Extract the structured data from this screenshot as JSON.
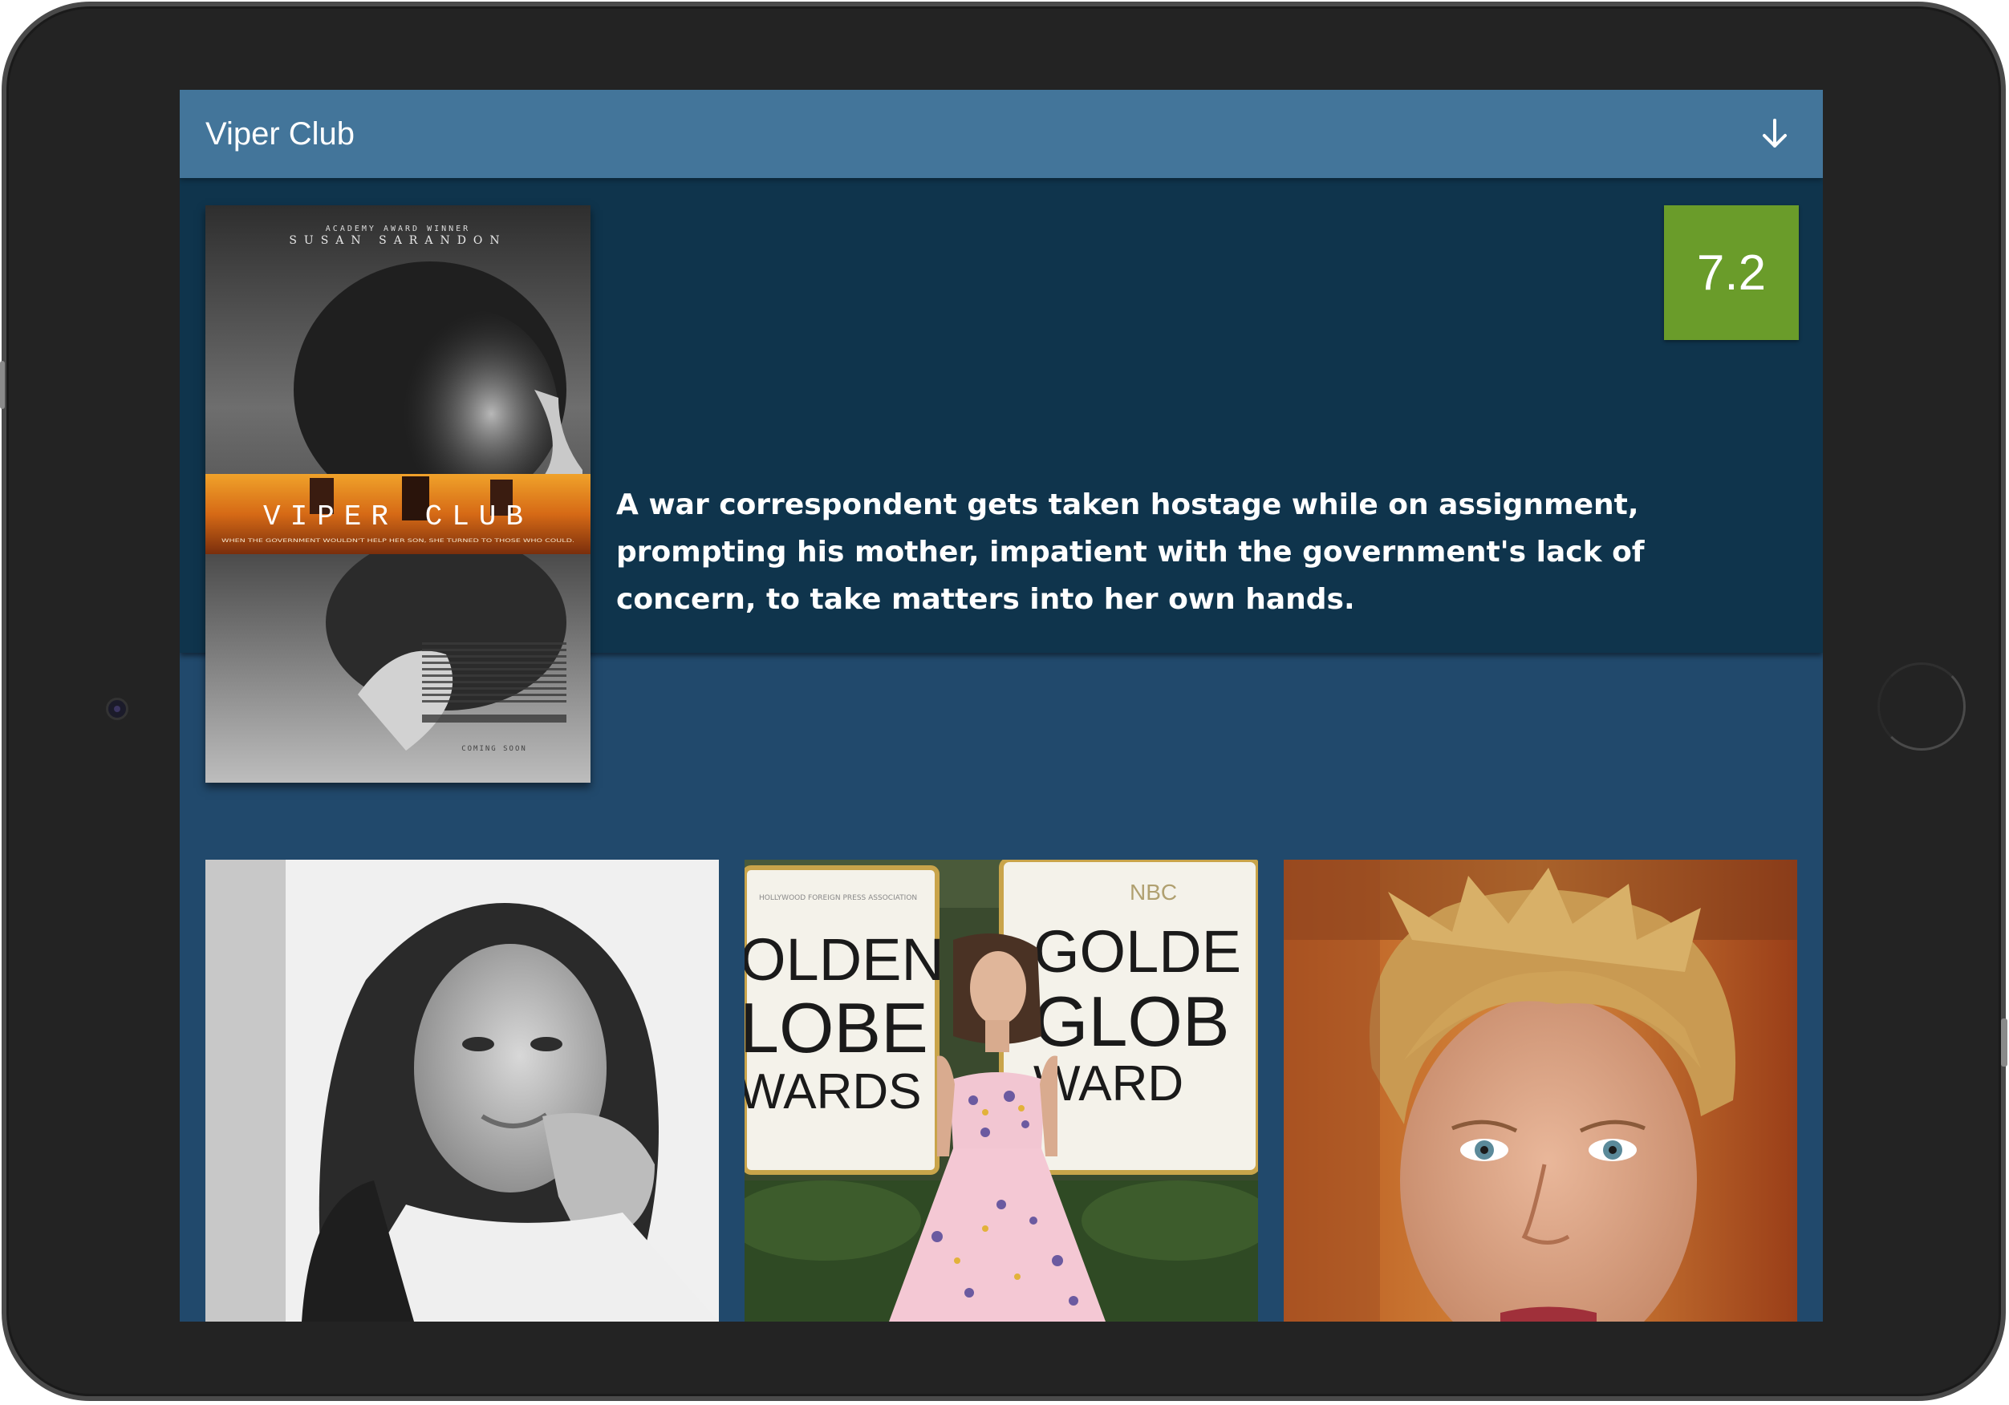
{
  "movie": {
    "title": "Viper Club",
    "rating": "7.2",
    "description": "A war correspondent gets taken hostage while on assignment, prompting his mother, impatient with the government's lack of concern, to take matters into her own hands."
  },
  "poster": {
    "top_credit": "ACADEMY AWARD WINNER",
    "actor_name": "SUSAN SARANDON",
    "title_text": "VIPER CLUB",
    "tagline": "WHEN THE GOVERNMENT WOULDN'T HELP HER SON, SHE TURNED TO THOSE WHO COULD.",
    "date_text": "COMING SOON"
  },
  "photo_2": {
    "sign_left_lines": [
      "OLDEN",
      "LOBE",
      "WARDS"
    ],
    "sign_right_lines": [
      "GOLDE",
      "GLOB",
      "WARD"
    ],
    "sign_network": "NBC",
    "sign_org": "HOLLYWOOD FOREIGN PRESS ASSOCIATION"
  },
  "colors": {
    "title_bar": "#43759a",
    "details_panel": "#0f344c",
    "page_background": "#21496c",
    "rating_badge": "#6a9c2a"
  },
  "icons": {
    "download": "arrow-down-icon"
  }
}
